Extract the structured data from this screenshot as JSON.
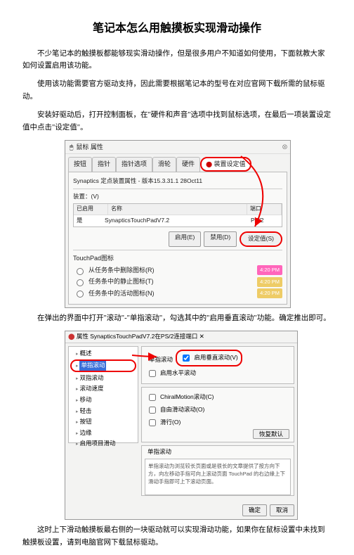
{
  "title": "笔记本怎么用触摸板实现滑动操作",
  "para1": "不少笔记本的触摸板都能够现实滑动操作，但是很多用户不知道如何使用，下面就教大家如何设置启用该功能。",
  "para2": "使用该功能需要官方驱动支持，因此需要根据笔记本的型号在对应官网下载所需的鼠标驱动。",
  "para3": "安装好驱动后，打开控制面板，在\"硬件和声音\"选项中找到鼠标选项，在最后一项装置设定值中点击\"设定值\"。",
  "para4": "在弹出的界面中打开\"滚动\"-\"单指滚动\"，勾选其中的\"启用垂直滚动\"功能。确定推出即可。",
  "para5": "这时上下滑动触摸板最右侧的一块驱动就可以实现滑动功能，如果你在鼠标设置中未找到触摸板设置，请到电脑官网下载鼠标驱动。",
  "dlg1": {
    "title": "鼠标 属性",
    "tabs": [
      "按钮",
      "指针",
      "指针选项",
      "滑轮",
      "硬件"
    ],
    "tab_sel": "装置设定值",
    "sub": "Synaptics 定点装置属性 - 版本15.3.31.1 28Oct11",
    "device_lbl": "装置：(V)",
    "cols": [
      "已启用",
      "名称",
      "端口"
    ],
    "vals": [
      "是",
      "SynapticsTouchPadV7.2",
      "PS/2"
    ],
    "btns": [
      "启用(E)",
      "禁用(D)",
      "设定值(S)"
    ],
    "sect": "TouchPad图标",
    "checks": [
      "从任务条中删除图标(R)",
      "任务条中的静止图标(T)",
      "任务条中的活动图标(N)"
    ],
    "time": "4:20 PM"
  },
  "dlg2": {
    "title": "属性 SynapticsTouchPadV7.2在PS/2连接端口",
    "tree": [
      "概述",
      "单指滚动",
      "双指滚动",
      "滚动速度",
      "移动",
      "轻击",
      "按钮",
      "边缘",
      "启用项目滑动"
    ],
    "right_title": "单指滚动",
    "checks": [
      {
        "label": "启用垂直滚动(V)",
        "checked": true
      },
      {
        "label": "启用水平滚动",
        "checked": false
      }
    ],
    "checks2": [
      {
        "label": "ChiralMotion滚动(C)",
        "checked": false
      },
      {
        "label": "自由滑动滚动(O)",
        "checked": false
      },
      {
        "label": "滑行(O)",
        "checked": false
      }
    ],
    "restore": "恢复默认",
    "desc_title": "单指滚动",
    "desc": "单指滚动为浏览较长页面或是很长的文章提供了按方向下方，向左移动手指可向上滚动页面 TouchPad 的右边缘上下滑动手指即可上下滚动页面。",
    "btns": [
      "确定",
      "取消"
    ]
  }
}
